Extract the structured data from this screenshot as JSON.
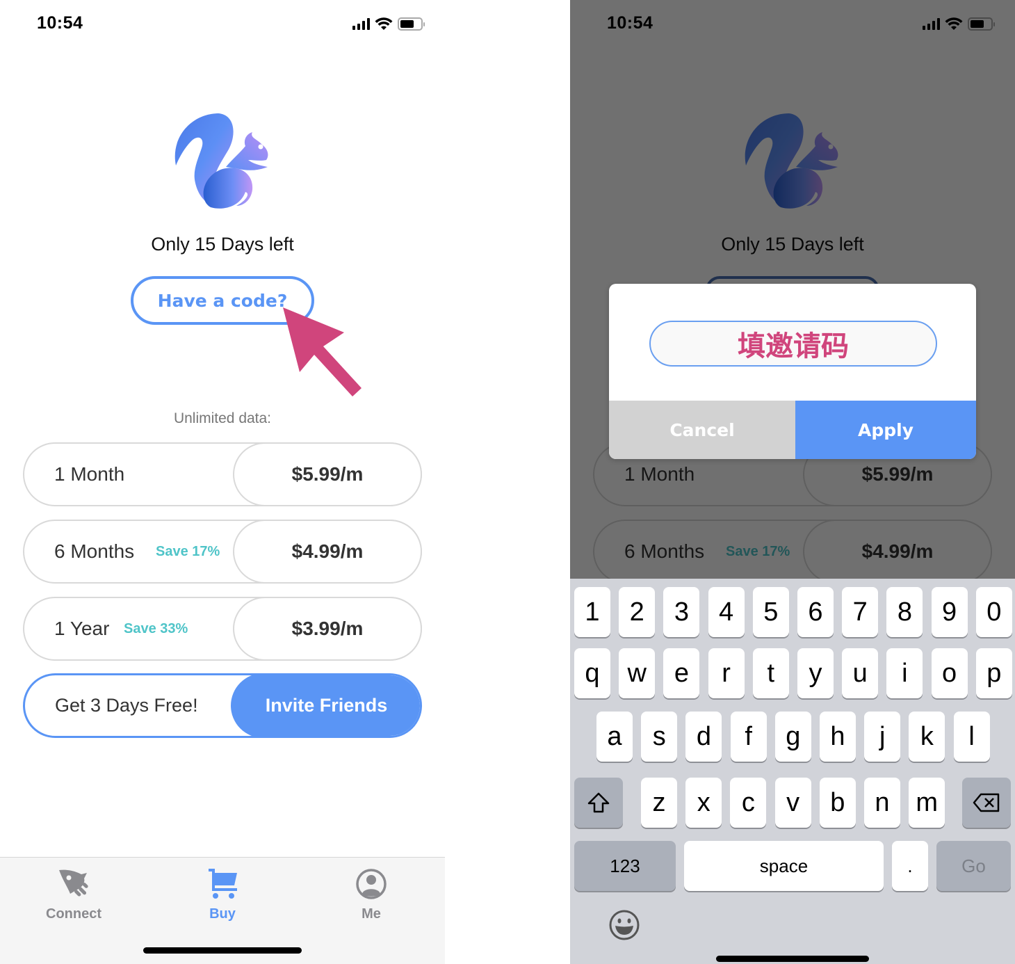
{
  "status_bar": {
    "time": "10:54"
  },
  "app": {
    "days_left": "Only 15 Days left",
    "have_code_label": "Have a code?",
    "unlimited_label": "Unlimited data:",
    "plans": [
      {
        "name": "1 Month",
        "save": "",
        "price": "$5.99/m"
      },
      {
        "name": "6 Months",
        "save": "Save 17%",
        "price": "$4.99/m"
      },
      {
        "name": "1 Year",
        "save": "Save 33%",
        "price": "$3.99/m"
      }
    ],
    "invite": {
      "text": "Get 3 Days Free!",
      "button": "Invite Friends"
    },
    "tabs": [
      {
        "label": "Connect",
        "icon": "rocket-icon",
        "active": false
      },
      {
        "label": "Buy",
        "icon": "cart-icon",
        "active": true
      },
      {
        "label": "Me",
        "icon": "profile-icon",
        "active": false
      }
    ]
  },
  "dialog": {
    "input_value": "填邀请码",
    "cancel_label": "Cancel",
    "apply_label": "Apply"
  },
  "keyboard": {
    "row_numbers": [
      "1",
      "2",
      "3",
      "4",
      "5",
      "6",
      "7",
      "8",
      "9",
      "0"
    ],
    "row_1": [
      "q",
      "w",
      "e",
      "r",
      "t",
      "y",
      "u",
      "i",
      "o",
      "p"
    ],
    "row_2": [
      "a",
      "s",
      "d",
      "f",
      "g",
      "h",
      "j",
      "k",
      "l"
    ],
    "row_3": [
      "z",
      "x",
      "c",
      "v",
      "b",
      "n",
      "m"
    ],
    "numbers_key": "123",
    "space_key": "space",
    "period_key": ".",
    "go_key": "Go"
  },
  "colors": {
    "accent": "#5a95f5",
    "save_badge": "#4fc4c8",
    "annotation": "#d0457c"
  }
}
